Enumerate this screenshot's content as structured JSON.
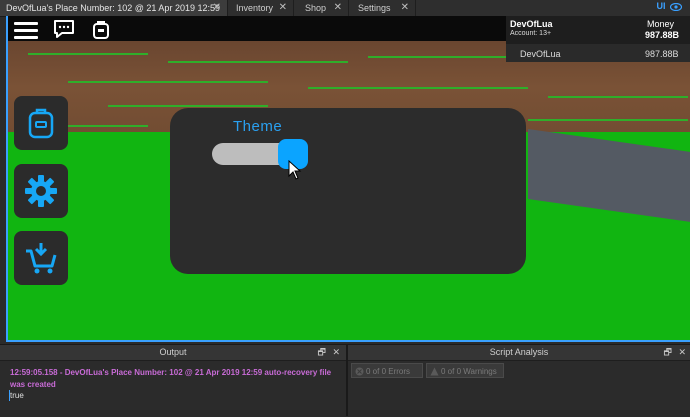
{
  "tabs": [
    {
      "label": "DevOfLua's Place Number: 102 @ 21 Apr 2019 12:59",
      "active": true,
      "close": "✕"
    },
    {
      "label": "Inventory",
      "active": false,
      "close": "✕"
    },
    {
      "label": "Shop",
      "active": false,
      "close": "✕"
    },
    {
      "label": "Settings",
      "active": false,
      "close": "✕"
    }
  ],
  "ui_toggle": {
    "label": "UI",
    "icon": "eye-icon"
  },
  "hud": {
    "menu_icon": "hamburger-icon",
    "chat_icon": "chat-icon",
    "backpack_icon": "backpack-icon"
  },
  "leaderboard": {
    "player_name": "DevOfLua",
    "account": "Account: 13+",
    "money_label": "Money",
    "money_value": "987.88B",
    "row_name": "DevOfLua",
    "row_money": "987.88B"
  },
  "side_buttons": [
    {
      "name": "inventory",
      "icon": "backpack-icon"
    },
    {
      "name": "settings",
      "icon": "gear-icon"
    },
    {
      "name": "shop",
      "icon": "cart-icon"
    }
  ],
  "settings_panel": {
    "theme_label": "Theme",
    "toggle_state": "on"
  },
  "output": {
    "title": "Output",
    "line1": "12:59:05.158 - DevOfLua's Place Number: 102 @ 21 Apr 2019 12:59 auto-recovery file was created",
    "line2": "true",
    "restore": "🗗",
    "close": "✕"
  },
  "script_analysis": {
    "title": "Script Analysis",
    "errors": "0 of 0 Errors",
    "warnings": "0 of 0 Warnings",
    "restore": "🗗",
    "close": "✕"
  },
  "colors": {
    "accent": "#0ba4ff",
    "grass": "#11b511",
    "dirt": "#7a5236",
    "panel": "#2c2c2c",
    "output_text": "#c86bd6"
  }
}
